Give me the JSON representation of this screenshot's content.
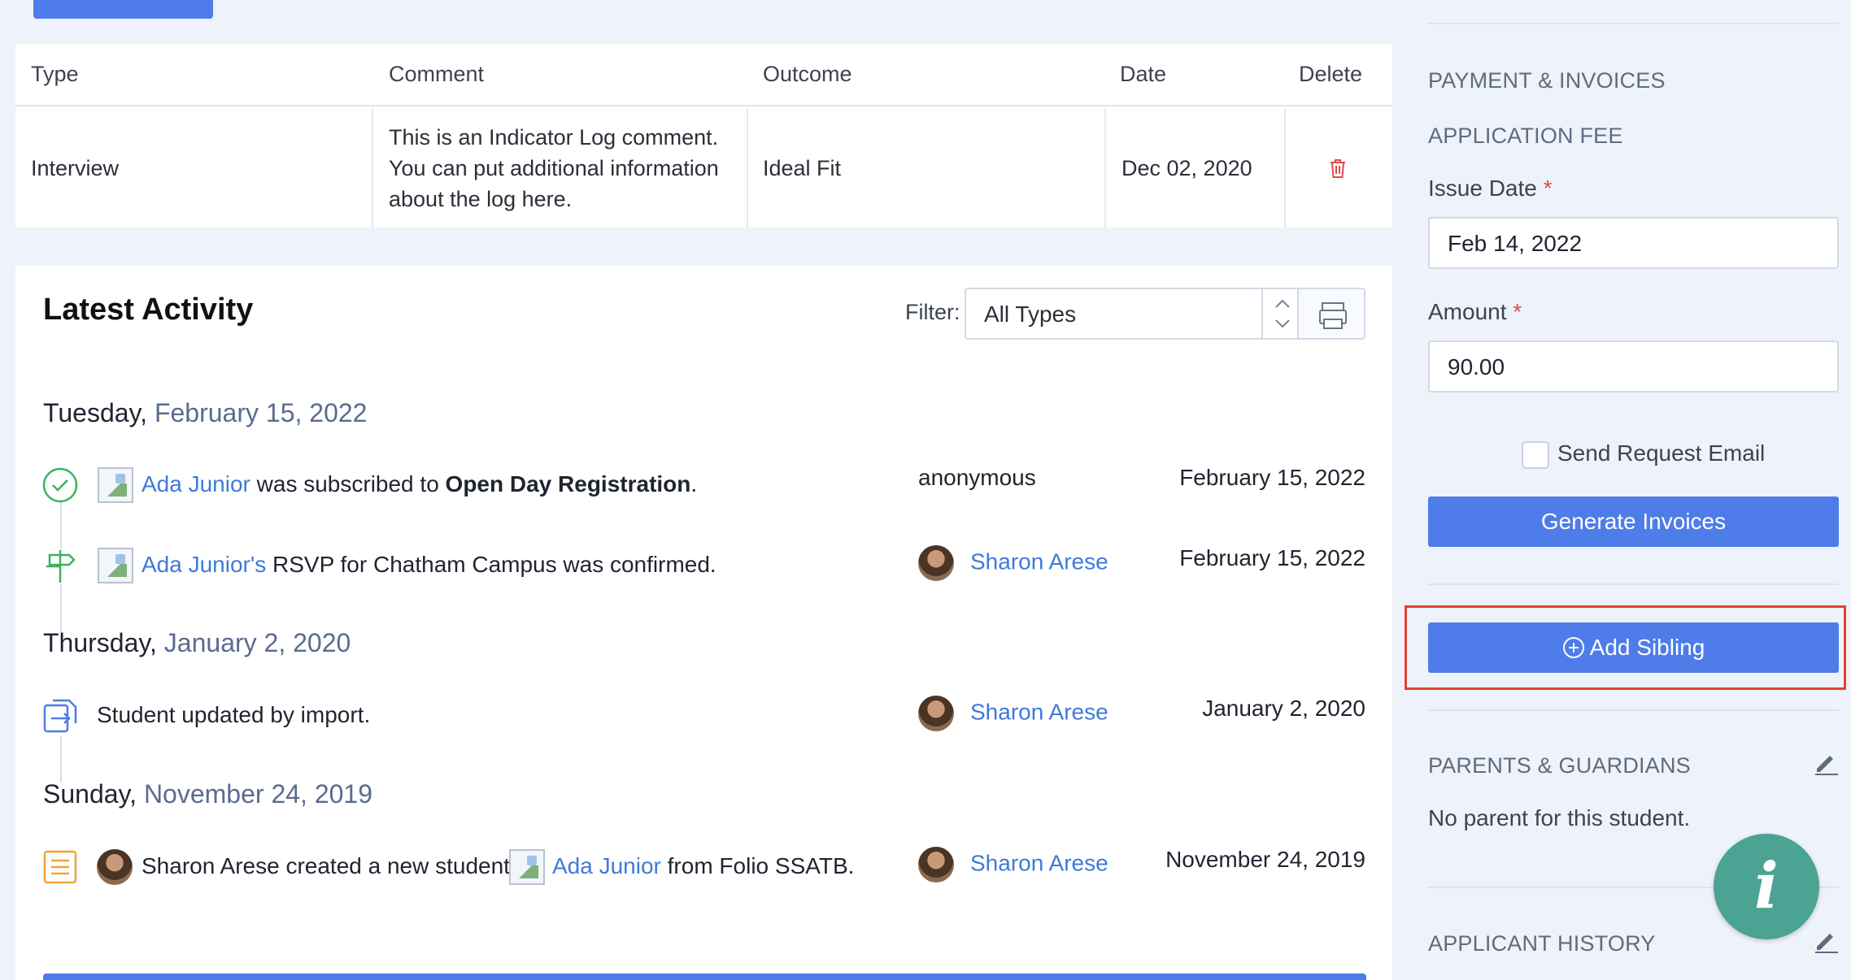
{
  "log_table": {
    "headers": [
      "Type",
      "Comment",
      "Outcome",
      "Date",
      "Delete"
    ],
    "row": {
      "type": "Interview",
      "comment_line1": "This is an Indicator Log comment.",
      "comment_line2": "You can put additional information",
      "comment_line3": "about the log here.",
      "outcome": "Ideal Fit",
      "date": "Dec 02, 2020",
      "delete_icon": "trash-icon"
    }
  },
  "activity": {
    "title": "Latest Activity",
    "filter_label": "Filter:",
    "filter_value": "All Types",
    "print_icon": "printer-icon",
    "groups": [
      {
        "weekday": "Tuesday,",
        "date": "February 15, 2022",
        "entries": [
          {
            "icon": "check-circle-icon",
            "link": "Ada Junior",
            "text_mid": " was subscribed to ",
            "bold": "Open Day Registration",
            "text_end": ".",
            "who": "anonymous",
            "when": "February 15, 2022"
          },
          {
            "icon": "signpost-icon",
            "link": "Ada Junior's",
            "text_mid": " RSVP for Chatham Campus was confirmed.",
            "who": "Sharon Arese",
            "when": "February 15, 2022"
          }
        ]
      },
      {
        "weekday": "Thursday,",
        "date": "January 2, 2020",
        "entries": [
          {
            "icon": "import-icon",
            "text": "Student updated by import.",
            "who": "Sharon Arese",
            "when": "January 2, 2020"
          }
        ]
      },
      {
        "weekday": "Sunday,",
        "date": "November 24, 2019",
        "entries": [
          {
            "icon": "document-list-icon",
            "text_pre": "Sharon Arese created a new student ",
            "link": "Ada Junior",
            "text_end": " from Folio SSATB.",
            "who": "Sharon Arese",
            "when": "November 24, 2019"
          }
        ]
      }
    ]
  },
  "sidebar": {
    "payment_title": "PAYMENT & INVOICES",
    "fee_title": "APPLICATION FEE",
    "issue_date_label": "Issue Date",
    "issue_date_value": "Feb 14, 2022",
    "amount_label": "Amount",
    "amount_value": "90.00",
    "required_mark": "*",
    "send_email_label": "Send Request Email",
    "generate_button": "Generate Invoices",
    "add_sibling_button": "Add Sibling",
    "parents_title": "PARENTS & GUARDIANS",
    "no_parent_text": "No parent for this student.",
    "history_title": "APPLICANT HISTORY",
    "info_button": "i"
  },
  "colors": {
    "accent": "#4e7ce8",
    "link": "#3f7ad9",
    "danger": "#e0474c",
    "highlight": "#e0432e",
    "fab": "#4aa393"
  }
}
